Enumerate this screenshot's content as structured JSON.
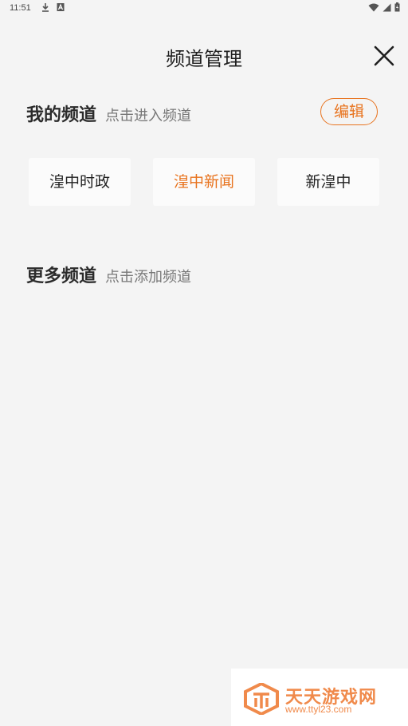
{
  "status_bar": {
    "time": "11:51"
  },
  "header": {
    "title": "频道管理"
  },
  "my_channels": {
    "title": "我的频道",
    "hint": "点击进入频道",
    "edit_label": "编辑",
    "items": [
      {
        "label": "湟中时政"
      },
      {
        "label": "湟中新闻"
      },
      {
        "label": "新湟中"
      }
    ],
    "active_index": 1
  },
  "more_channels": {
    "title": "更多频道",
    "hint": "点击添加频道"
  },
  "watermark": {
    "title": "天天游戏网",
    "url": "www.ttyl23.com"
  },
  "colors": {
    "accent": "#e8731e",
    "background": "#f4f4f4"
  },
  "icons": {
    "status_left": [
      "download-icon",
      "notification-a-icon"
    ],
    "status_right": [
      "wifi-icon",
      "signal-icon",
      "battery-icon"
    ],
    "close": "close-icon"
  }
}
